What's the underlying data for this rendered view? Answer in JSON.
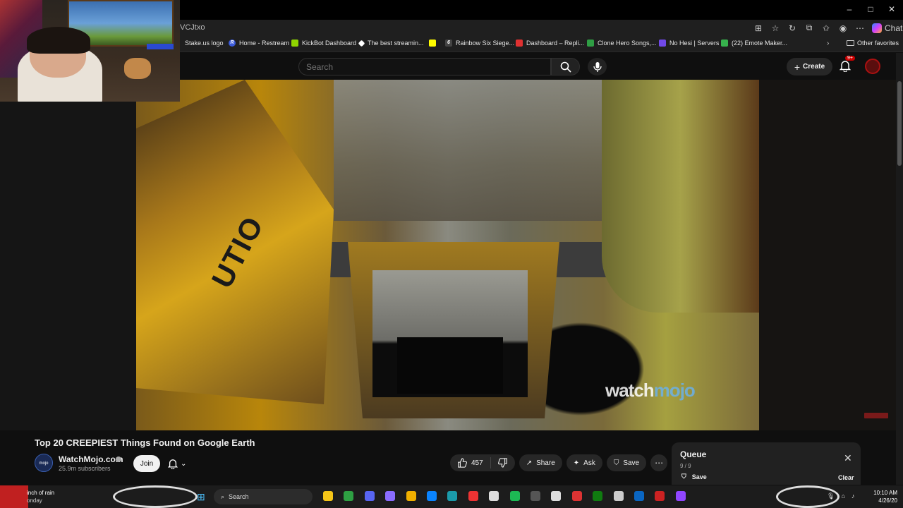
{
  "browser": {
    "url": "VCJtxo",
    "window_controls": [
      "–",
      "□",
      "✕"
    ],
    "copilot_label": "Chat",
    "bookmarks": [
      {
        "label": "Stake.us logo",
        "color": "#1a1a1a"
      },
      {
        "label": "Home - Restream",
        "color": "#3b5bdb"
      },
      {
        "label": "KickBot Dashboard",
        "color": "#8fd400"
      },
      {
        "label": "The best streamin...",
        "color": "#ffffff"
      },
      {
        "label": "",
        "color": "#fffc00"
      },
      {
        "label": "Rainbow Six Siege...",
        "color": "#444444"
      },
      {
        "label": "Dashboard – Repli...",
        "color": "#e03131"
      },
      {
        "label": "Clone Hero Songs,...",
        "color": "#2f9e44"
      },
      {
        "label": "No Hesi | Servers",
        "color": "#7048e8"
      },
      {
        "label": "(22) Emote Maker...",
        "color": "#37b24d"
      }
    ],
    "other_favorites": "Other favorites"
  },
  "youtube": {
    "search_placeholder": "Search",
    "create_label": "Create",
    "notification_count": "9+"
  },
  "video": {
    "title": "Top 20 CREEPIEST Things Found on Google Earth",
    "overlay_sign_text": "UTIO",
    "watermark_a": "watch",
    "watermark_b": "mojo",
    "channel": {
      "name": "WatchMojo.com",
      "subscribers": "25.9m subscribers",
      "avatar_text": "mojo"
    },
    "join_label": "Join",
    "likes": "457",
    "share_label": "Share",
    "ask_label": "Ask",
    "save_label": "Save",
    "more_label": "⋯"
  },
  "queue": {
    "title": "Queue",
    "count": "9 / 9",
    "save_label": "Save",
    "clear_label": "Clear"
  },
  "taskbar": {
    "weather_line1": "inch of rain",
    "weather_line2": "onday",
    "search_label": "Search",
    "time": "10:10 AM",
    "date": "4/26/20",
    "icon_colors": [
      "#f5c518",
      "#2ea043",
      "#5865f2",
      "#8a6cff",
      "#f0b000",
      "#0a84ff",
      "#1b9aaa",
      "#e33",
      "#ddd",
      "#1db954",
      "#555",
      "#ddd",
      "#d33",
      "#107c10",
      "#ccc",
      "#0a66c2",
      "#c22",
      "#9146ff"
    ]
  }
}
